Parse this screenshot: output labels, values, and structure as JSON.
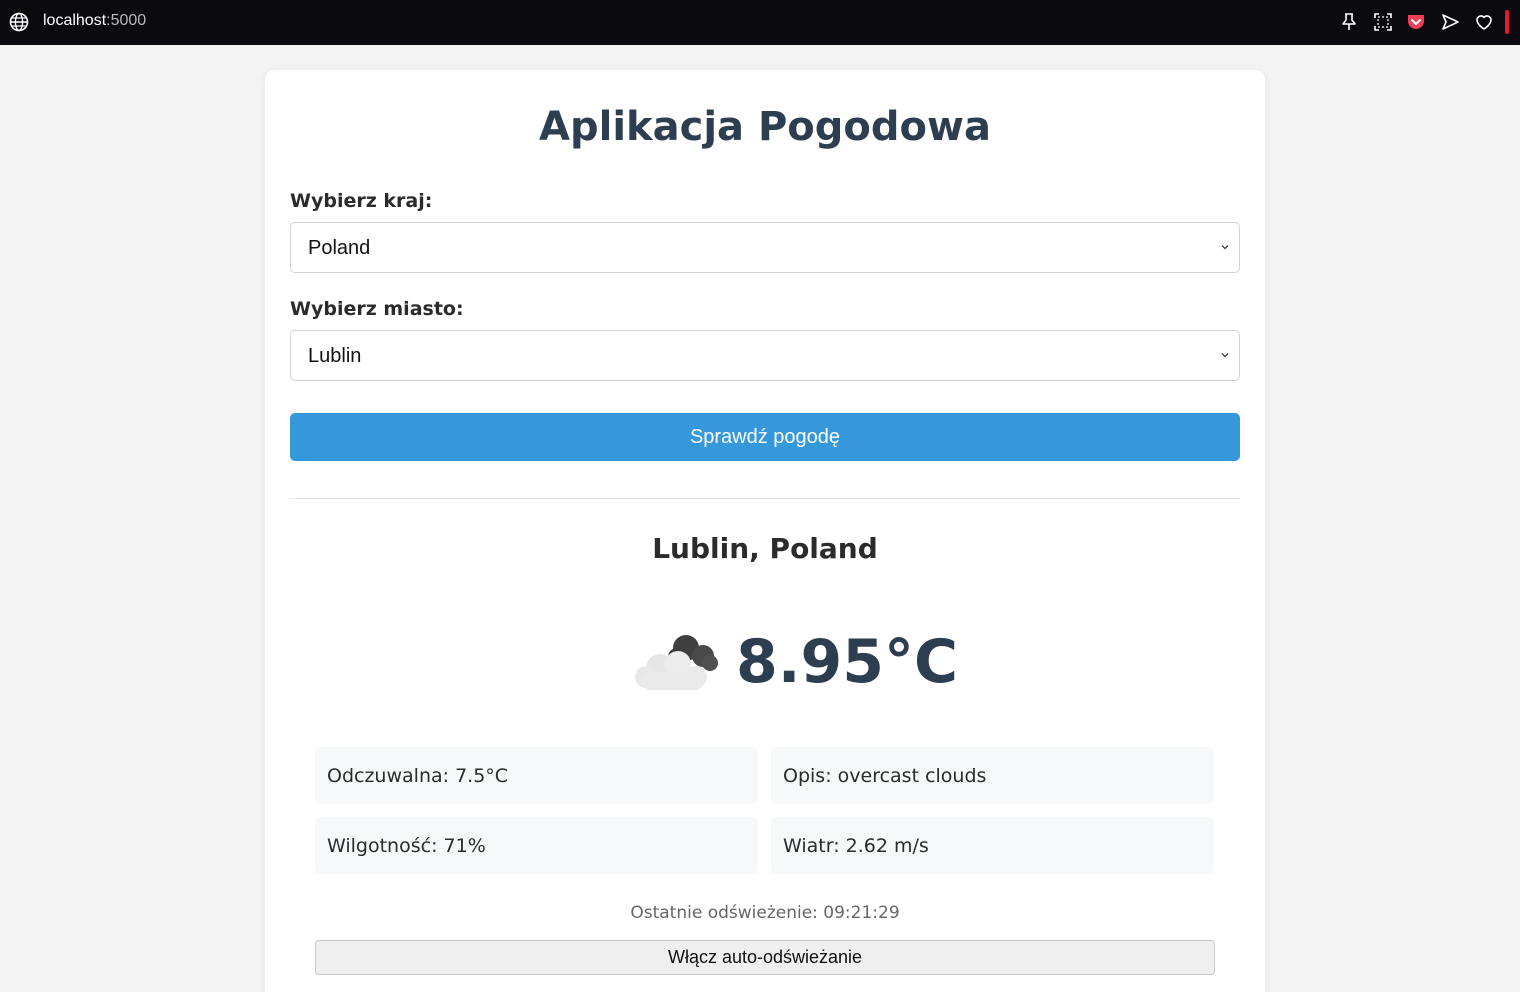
{
  "browser": {
    "url_host": "localhost",
    "url_port": ":5000",
    "icons": [
      "globe-icon",
      "pin-icon",
      "screenshot-icon",
      "pocket-icon",
      "send-icon",
      "heart-icon"
    ],
    "accent_color": "#e3193b"
  },
  "app": {
    "title": "Aplikacja Pogodowa",
    "country_label": "Wybierz kraj:",
    "country_value": "Poland",
    "city_label": "Wybierz miasto:",
    "city_value": "Lublin",
    "check_button": "Sprawdź pogodę",
    "primary_color": "#3498db",
    "heading_color": "#2c3e50"
  },
  "weather": {
    "location": "Lublin, Poland",
    "icon": "overcast-clouds-icon",
    "temperature": "8.95°C",
    "feels_like": "Odczuwalna: 7.5°C",
    "description": "Opis: overcast clouds",
    "humidity": "Wilgotność: 71%",
    "wind": "Wiatr: 2.62 m/s",
    "last_refresh": "Ostatnie odświeżenie: 09:21:29",
    "auto_refresh_button": "Włącz auto-odświeżanie"
  }
}
